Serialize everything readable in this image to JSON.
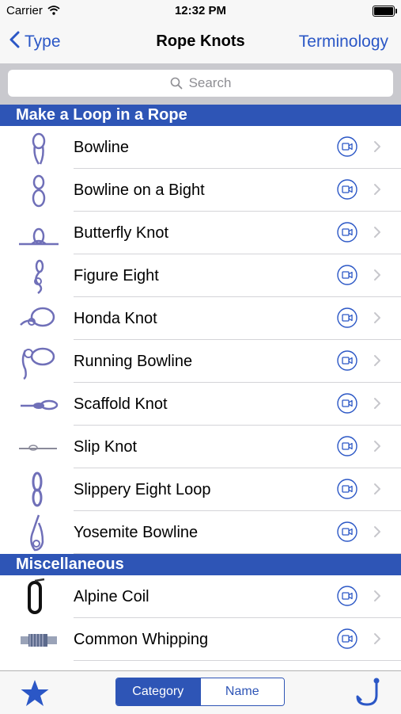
{
  "status_bar": {
    "carrier": "Carrier",
    "time": "12:32 PM"
  },
  "nav": {
    "back_label": "Type",
    "title": "Rope Knots",
    "right_label": "Terminology"
  },
  "search": {
    "placeholder": "Search"
  },
  "sections": [
    {
      "title": "Make a Loop in a Rope",
      "items": [
        "Bowline",
        "Bowline on a Bight",
        "Butterfly Knot",
        "Figure Eight",
        "Honda Knot",
        "Running Bowline",
        "Scaffold Knot",
        "Slip Knot",
        "Slippery Eight Loop",
        "Yosemite Bowline"
      ]
    },
    {
      "title": "Miscellaneous",
      "items": [
        "Alpine Coil",
        "Common Whipping"
      ]
    }
  ],
  "tab_bar": {
    "segment_selected": "Category",
    "segment_other": "Name"
  },
  "icons": {
    "back": "chevron-left-icon",
    "search": "magnifier-icon",
    "video": "video-icon",
    "disclosure": "chevron-right-icon",
    "favorites": "star-icon",
    "hook": "hook-icon"
  },
  "colors": {
    "accent": "#2b57c6",
    "section_header": "#2e55b6",
    "knot": "#6f6fb8"
  }
}
